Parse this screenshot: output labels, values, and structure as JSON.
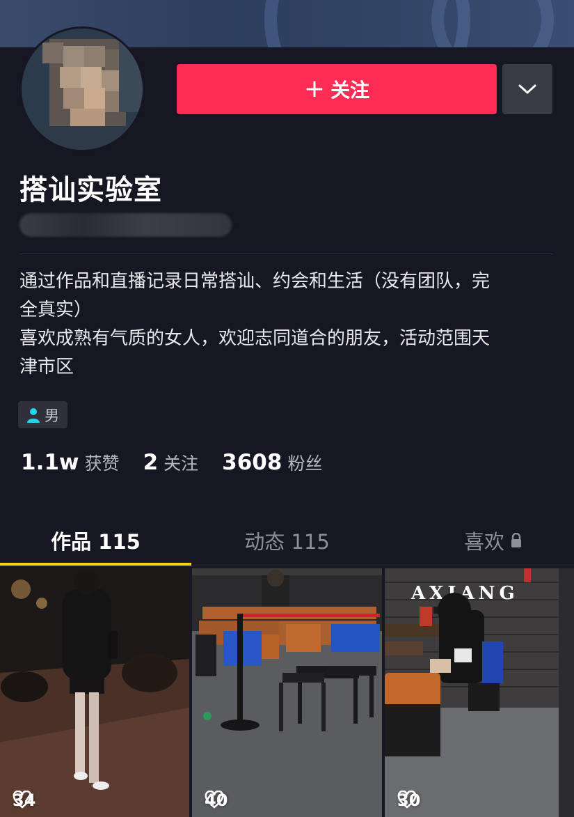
{
  "profile": {
    "name": "搭讪实验室",
    "bio_lines": [
      "通过作品和直播记录日常搭讪、约会和生活（没有团队，完",
      "全真实）",
      "喜欢成熟有气质的女人，欢迎志同道合的朋友，活动范围天",
      "津市区"
    ],
    "gender": "男",
    "follow_label": "关注",
    "follow_plus": "+"
  },
  "stats": [
    {
      "value": "1.1w",
      "label": "获赞"
    },
    {
      "value": "2",
      "label": "关注"
    },
    {
      "value": "3608",
      "label": "粉丝"
    }
  ],
  "tabs": [
    {
      "label": "作品 115",
      "active": true
    },
    {
      "label": "动态 115",
      "active": false
    },
    {
      "label": "喜欢",
      "active": false,
      "locked": true
    }
  ],
  "videos": [
    {
      "likes": "34"
    },
    {
      "likes": "40"
    },
    {
      "likes": "30",
      "sign_text": "AXIANG"
    }
  ],
  "colors": {
    "background": "#161723",
    "follow_button": "#fe2c55",
    "more_button": "#393b44",
    "tab_indicator": "#facf1f",
    "gender_icon": "#20d5ec"
  },
  "icons": {
    "more": "chevron-down-icon",
    "gender": "person-icon",
    "locked": "lock-icon",
    "likes": "heart-icon"
  }
}
